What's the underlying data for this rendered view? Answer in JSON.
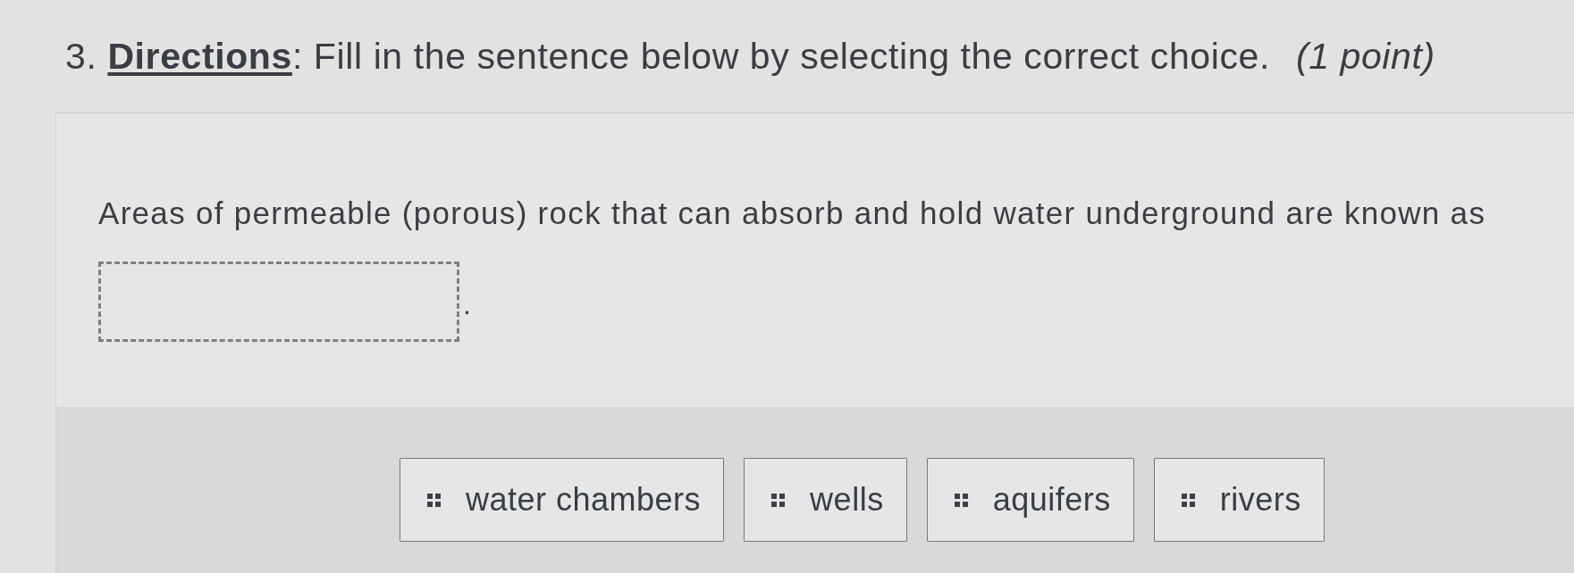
{
  "question": {
    "heading": "3. **Directions**: Fill in the sentence below by selecting the correct choice.",
    "points": "(1 point)"
  },
  "prompt": {
    "sentence": "Areas of permeable (porous) rock that can absorb and hold water underground are known as",
    "blank_end": "."
  },
  "choices": [
    {
      "label": "water chambers"
    },
    {
      "label": "wells"
    },
    {
      "label": "aquifers"
    },
    {
      "label": "rivers"
    }
  ]
}
